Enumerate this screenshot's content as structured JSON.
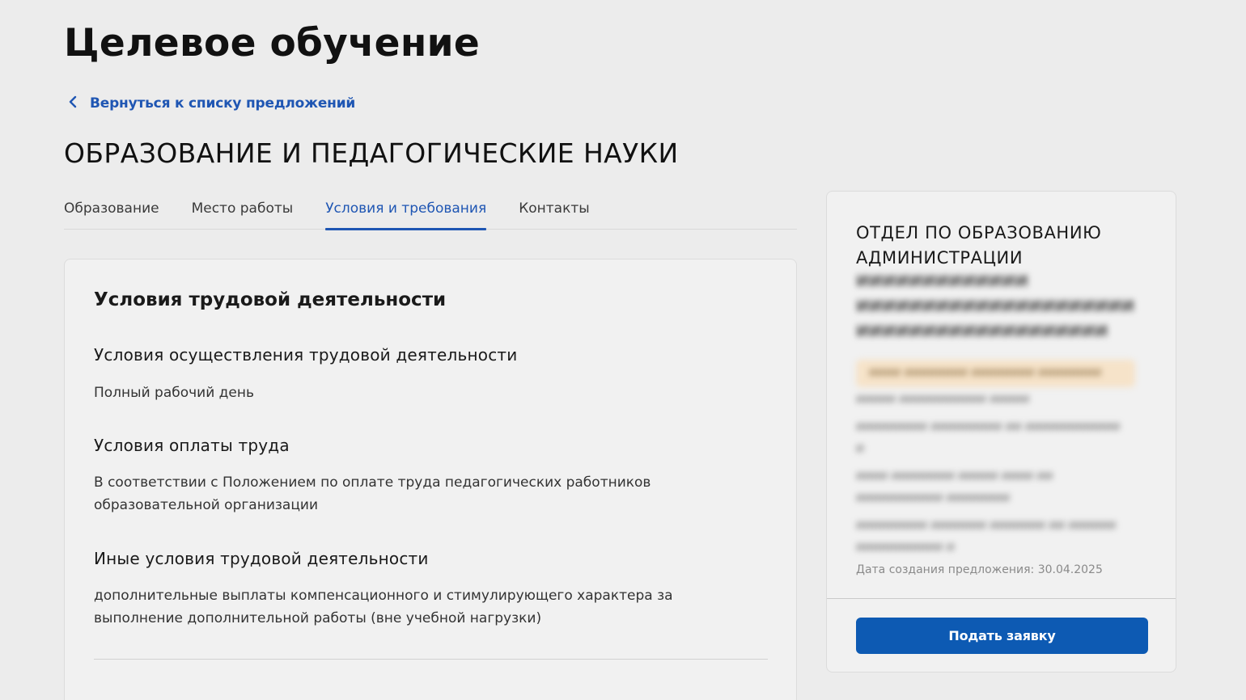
{
  "header": {
    "title": "Целевое обучение",
    "back_link": "Вернуться к списку предложений",
    "section_title": "ОБРАЗОВАНИЕ И ПЕДАГОГИЧЕСКИЕ НАУКИ"
  },
  "tabs": [
    {
      "label": "Образование",
      "active": false
    },
    {
      "label": "Место работы",
      "active": false
    },
    {
      "label": "Условия и требования",
      "active": true
    },
    {
      "label": "Контакты",
      "active": false
    }
  ],
  "main": {
    "heading": "Условия трудовой деятельности",
    "blocks": [
      {
        "title": "Условия осуществления трудовой деятельности",
        "text": "Полный рабочий день"
      },
      {
        "title": "Условия оплаты труда",
        "text": "В соответствии с Положением по оплате труда педагогических работников образовательной организации"
      },
      {
        "title": "Иные условия трудовой деятельности",
        "text": "дополнительные выплаты компенсационного и стимулирующего характера за выполнение дополнительной работы (вне учебной нагрузки)"
      }
    ]
  },
  "sidebar": {
    "org_name": "ОТДЕЛ ПО ОБРАЗОВАНИЮ АДМИНИСТРАЦИИ",
    "created_date": "Дата создания предложения: 30.04.2025",
    "apply_button": "Подать заявку"
  },
  "colors": {
    "accent": "#1f56b3",
    "button": "#0d5ab3",
    "background": "#ececec",
    "card": "#f1f1f1",
    "badge": "#f6e3c9"
  },
  "icons": {
    "back": "chevron-left-icon"
  }
}
